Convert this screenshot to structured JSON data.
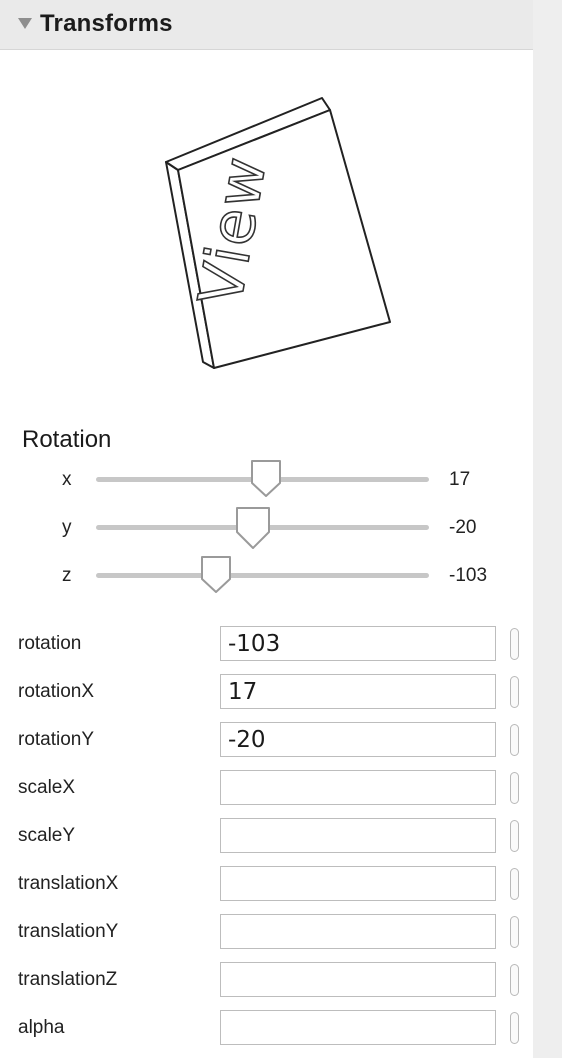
{
  "header": {
    "title": "Transforms",
    "icon": "disclosure-triangle-icon"
  },
  "preview": {
    "label": "View"
  },
  "rotation_section": {
    "title": "Rotation",
    "sliders": [
      {
        "axis": "x",
        "value": "17",
        "fraction": 0.51
      },
      {
        "axis": "y",
        "value": "-20",
        "fraction": 0.47
      },
      {
        "axis": "z",
        "value": "-103",
        "fraction": 0.36
      }
    ]
  },
  "properties": [
    {
      "name": "rotation",
      "value": "-103"
    },
    {
      "name": "rotationX",
      "value": "17"
    },
    {
      "name": "rotationY",
      "value": "-20"
    },
    {
      "name": "scaleX",
      "value": ""
    },
    {
      "name": "scaleY",
      "value": ""
    },
    {
      "name": "translationX",
      "value": ""
    },
    {
      "name": "translationY",
      "value": ""
    },
    {
      "name": "translationZ",
      "value": ""
    },
    {
      "name": "alpha",
      "value": ""
    }
  ],
  "colors": {
    "header_bg": "#eaeaea",
    "track": "#c7c7c7",
    "thumb_fill": "#ffffff",
    "thumb_stroke": "#9a9a9a"
  }
}
